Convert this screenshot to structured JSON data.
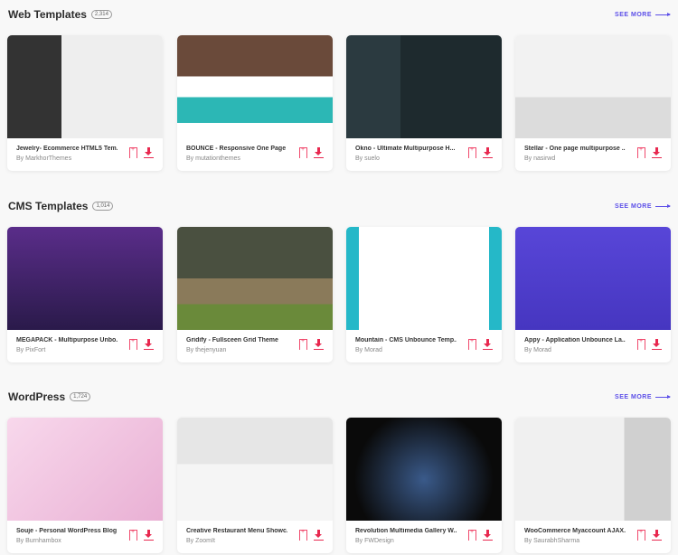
{
  "sections": [
    {
      "title": "Web Templates",
      "count": "2,314",
      "see_more": "SEE MORE",
      "items": [
        {
          "title": "Jewelry- Ecommerce HTML5 Tem...",
          "author": "By MarkhorThemes",
          "thumb": "linear-gradient(90deg,#333 0 35%,#eee 35% 100%)"
        },
        {
          "title": "BOUNCE - Responsive One Page ...",
          "author": "By mutationthemes",
          "thumb": "linear-gradient(180deg,#6a4a3a 0 40%,#fff 40% 60%,#2cb7b5 60% 85%,#fff 85%)"
        },
        {
          "title": "Okno - Ultimate Multipurpose H...",
          "author": "By suelo",
          "thumb": "linear-gradient(90deg,#2b3a40 0 35%,#1e2a2e 35% 100%)"
        },
        {
          "title": "Stellar - One page multipurpose ...",
          "author": "By nasirwd",
          "thumb": "linear-gradient(180deg,#f2f2f2 0 60%,#dcdcdc 60%)"
        }
      ]
    },
    {
      "title": "CMS Templates",
      "count": "1,014",
      "see_more": "SEE MORE",
      "items": [
        {
          "title": "MEGAPACK - Multipurpose Unbo...",
          "author": "By PixFort",
          "thumb": "linear-gradient(180deg,#5a2d8a,#2a1a4a)"
        },
        {
          "title": "Gridify - Fullsceen Grid Theme",
          "author": "By thejenyuan",
          "thumb": "linear-gradient(180deg,#4a5040 0 50%,#8a7a5a 50% 75%,#6a8a3a 75%)"
        },
        {
          "title": "Mountain - CMS Unbounce Temp...",
          "author": "By Morad",
          "thumb": "linear-gradient(90deg,#25b8c8 0 8%,#fff 8% 92%,#25b8c8 92%)"
        },
        {
          "title": "Appy - Application Unbounce La...",
          "author": "By Morad",
          "thumb": "linear-gradient(180deg,#5846d8,#4636c0)"
        }
      ]
    },
    {
      "title": "WordPress",
      "count": "1,724",
      "see_more": "SEE MORE",
      "items": [
        {
          "title": "Souje - Personal WordPress Blog ...",
          "author": "By Burnhambox",
          "thumb": "linear-gradient(135deg,#f8d8ec,#e9b0d4)"
        },
        {
          "title": "Creative Restaurant Menu Showc...",
          "author": "By ZoomIt",
          "thumb": "linear-gradient(180deg,#e6e6e6 0 45%,#f5f5f5 45%)"
        },
        {
          "title": "Revolution Multimedia Gallery W...",
          "author": "By FWDesign",
          "thumb": "radial-gradient(circle at 50% 60%,#3a5a8a,#0a0a0a 70%)"
        },
        {
          "title": "WooCommerce Myaccount AJAX...",
          "author": "By SaurabhSharma",
          "thumb": "linear-gradient(90deg,#f0f0f0 0 70%,#d0d0d0 70%)"
        }
      ]
    }
  ]
}
